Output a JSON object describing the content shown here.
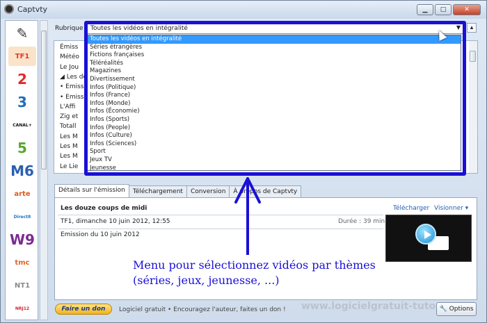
{
  "window": {
    "title": "Captvty"
  },
  "channels": [
    {
      "name": "magic-wand",
      "label": "",
      "color": "#333333"
    },
    {
      "name": "tf1",
      "label": "TF1",
      "color": "#e33b2a"
    },
    {
      "name": "france2",
      "label": "2",
      "color": "#e12b2b"
    },
    {
      "name": "france3",
      "label": "3",
      "color": "#1f6fb8"
    },
    {
      "name": "canalplus",
      "label": "CANAL+",
      "color": "#111111"
    },
    {
      "name": "france5",
      "label": "5",
      "color": "#58a82c"
    },
    {
      "name": "m6",
      "label": "M6",
      "color": "#2b5fb0"
    },
    {
      "name": "arte",
      "label": "arte",
      "color": "#e05b1d"
    },
    {
      "name": "direct8",
      "label": "Direct8",
      "color": "#1e73c8"
    },
    {
      "name": "w9",
      "label": "W9",
      "color": "#7b2b8f"
    },
    {
      "name": "tmc",
      "label": "tmc",
      "color": "#e0662a"
    },
    {
      "name": "nt1",
      "label": "NT1",
      "color": "#8a8a8a"
    },
    {
      "name": "nrj12",
      "label": "NRJ12",
      "color": "#d3232a"
    }
  ],
  "rubrique": {
    "label": "Rubrique :",
    "selected": "Toutes les vidéos en intégralité"
  },
  "dropdown_options": [
    "Toutes les vidéos en intégralité",
    "Séries étrangères",
    "Fictions françaises",
    "Téléréalités",
    "Magazines",
    "Divertissement",
    "Infos (Politique)",
    "Infos (France)",
    "Infos (Monde)",
    "Infos (Économie)",
    "Infos (Sports)",
    "Infos (People)",
    "Infos (Culture)",
    "Infos (Sciences)",
    "Sport",
    "Jeux TV",
    "Jeunesse"
  ],
  "list_items": [
    {
      "text": "Émiss",
      "bullet": ""
    },
    {
      "text": "Météo",
      "bullet": ""
    },
    {
      "text": "Le Jou",
      "bullet": ""
    },
    {
      "text": "Les do",
      "bullet": "◢"
    },
    {
      "text": "Emiss",
      "bullet": "•"
    },
    {
      "text": "Emiss",
      "bullet": "•"
    },
    {
      "text": "L'Affi",
      "bullet": ""
    },
    {
      "text": "Zig et",
      "bullet": ""
    },
    {
      "text": "Totall",
      "bullet": ""
    },
    {
      "text": "Les M",
      "bullet": ""
    },
    {
      "text": "Les M",
      "bullet": ""
    },
    {
      "text": "Les M",
      "bullet": ""
    },
    {
      "text": "Le Lie",
      "bullet": ""
    }
  ],
  "tabs": [
    {
      "label": "Détails sur l'émission"
    },
    {
      "label": "Téléchargement"
    },
    {
      "label": "Conversion"
    },
    {
      "label": "À propos de Captvty"
    }
  ],
  "details": {
    "title": "Les douze coups de midi",
    "download_link": "Télécharger",
    "view_link": "Visionner ▾",
    "info": "TF1, dimanche 10 juin 2012, 12:55",
    "duration": "Durée : 39 min.",
    "description": "Emission du 10 juin 2012"
  },
  "annotation": {
    "line1": "Menu pour sélectionnez vidéos par thèmes",
    "line2": "(séries, jeux, jeunesse, ...)"
  },
  "footer": {
    "donate": "Faire un don",
    "text": "Logiciel gratuit  •  Encouragez l'auteur, faites un don !",
    "watermark": "www.logicielgratuit-tuto.com",
    "options": "Options"
  },
  "colors": {
    "highlight": "#1a10d6",
    "selection": "#3399ff"
  }
}
